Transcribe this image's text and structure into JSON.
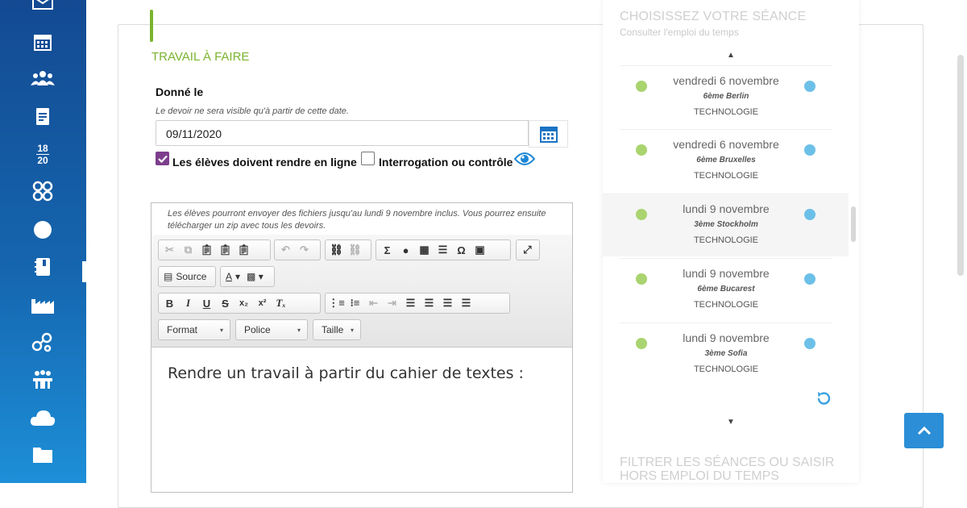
{
  "sidebar": {
    "icons": [
      "mail-icon",
      "calendar-icon",
      "users-icon",
      "clipboard-icon",
      "grades-icon",
      "skills-icon",
      "circle-icon",
      "notebook-icon",
      "factory-icon",
      "network-icon",
      "meeting-icon",
      "cloud-icon",
      "folder-icon"
    ],
    "grade_top": "18",
    "grade_bottom": "20",
    "active": "notebook-icon"
  },
  "form": {
    "section_title": "TRAVAIL À FAIRE",
    "given_label": "Donné le",
    "given_hint": "Le devoir ne sera visible qu'à partir de cette date.",
    "date_value": "09/11/2020",
    "checkbox_submit_label": "Les élèves doivent rendre en ligne",
    "checkbox_submit_checked": true,
    "checkbox_test_label": "Interrogation ou contrôle",
    "checkbox_test_checked": false
  },
  "editor": {
    "note": "Les élèves pourront envoyer des fichiers jusqu'au lundi 9 novembre inclus. Vous pourrez ensuite télécharger un zip avec tous les devoirs.",
    "source_label": "Source",
    "format_label": "Format",
    "font_label": "Police",
    "size_label": "Taille",
    "content": "Rendre un travail à partir du cahier de textes :"
  },
  "sessions_panel": {
    "title": "CHOISISSEZ VOTRE SÉANCE",
    "subtitle": "Consulter l'emploi du temps",
    "filter_title": "FILTRER LES SÉANCES OU SAISIR HORS EMPLOI DU TEMPS",
    "sessions": [
      {
        "date": "vendredi 6 novembre",
        "class": "6ème Berlin",
        "subject": "TECHNOLOGIE"
      },
      {
        "date": "vendredi 6 novembre",
        "class": "6ème Bruxelles",
        "subject": "TECHNOLOGIE"
      },
      {
        "date": "lundi 9 novembre",
        "class": "3ème Stockholm",
        "subject": "TECHNOLOGIE"
      },
      {
        "date": "lundi 9 novembre",
        "class": "6ème Bucarest",
        "subject": "TECHNOLOGIE"
      },
      {
        "date": "lundi 9 novembre",
        "class": "3ème Sofia",
        "subject": "TECHNOLOGIE"
      }
    ],
    "active_index": 2
  },
  "colors": {
    "accent_green": "#7ab32e",
    "checkbox_purple": "#7d3e8c",
    "primary_blue": "#2b8ed6",
    "dot_green": "#a9d46f",
    "dot_blue": "#6cc0e8"
  }
}
